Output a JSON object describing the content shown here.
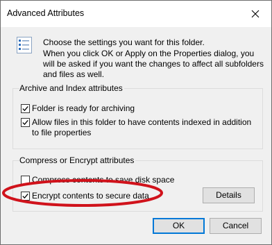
{
  "window": {
    "title": "Advanced Attributes"
  },
  "info": {
    "line1": "Choose the settings you want for this folder.",
    "line2": "When you click OK or Apply on the Properties dialog, you will be asked if you want the changes to affect all subfolders and files as well."
  },
  "archive_group": {
    "label": "Archive and Index attributes",
    "ready_label": "Folder is ready for archiving",
    "ready_checked": true,
    "index_label": "Allow files in this folder to have contents indexed in addition to file properties",
    "index_checked": true
  },
  "compress_group": {
    "label": "Compress or Encrypt attributes",
    "compress_label": "Compress contents to save disk space",
    "compress_checked": false,
    "encrypt_label": "Encrypt contents to secure data",
    "encrypt_checked": true,
    "details_label": "Details"
  },
  "footer": {
    "ok_label": "OK",
    "cancel_label": "Cancel"
  },
  "colors": {
    "highlight_ellipse": "#d0121b",
    "ok_border": "#0078d7",
    "dialog_bg": "#f0f0f0"
  },
  "icons": {
    "title_close": "close-icon",
    "info": "settings-list-icon"
  }
}
